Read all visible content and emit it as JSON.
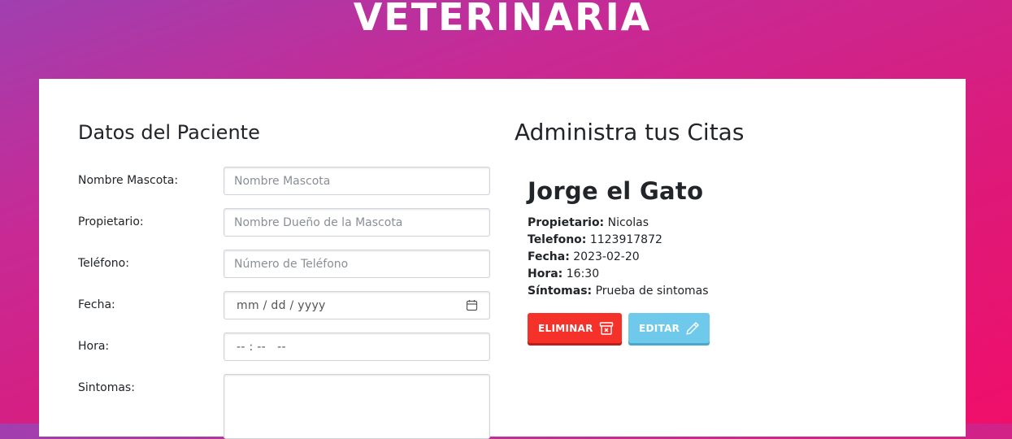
{
  "header": {
    "title": "VETERINARIA"
  },
  "form": {
    "title": "Datos del Paciente",
    "fields": [
      {
        "label": "Nombre Mascota:",
        "placeholder": "Nombre Mascota"
      },
      {
        "label": "Propietario:",
        "placeholder": "Nombre Dueño de la Mascota"
      },
      {
        "label": "Teléfono:",
        "placeholder": "Número de Teléfono"
      },
      {
        "label": "Fecha:",
        "display": "mm / dd / yyyy"
      },
      {
        "label": "Hora:",
        "display": "-- : --   --"
      },
      {
        "label": "Sintomas:",
        "placeholder": ""
      }
    ]
  },
  "list": {
    "title": "Administra tus Citas",
    "appointments": [
      {
        "pet": "Jorge el Gato",
        "owner_label": "Propietario:",
        "owner": "Nicolas",
        "phone_label": "Telefono:",
        "phone": "1123917872",
        "date_label": "Fecha:",
        "date": "2023-02-20",
        "time_label": "Hora:",
        "time": "16:30",
        "symptoms_label": "Síntomas:",
        "symptoms": "Prueba de sintomas",
        "delete_label": "ELIMINAR",
        "edit_label": "EDITAR"
      }
    ]
  },
  "icons": {
    "calendar": "calendar-icon",
    "delete": "archive-x-icon",
    "edit": "pencil-icon"
  },
  "colors": {
    "gradient_start": "#a03fb0",
    "gradient_end": "#ef0f6a",
    "danger": "#f4322a",
    "info": "#6ec9ea"
  }
}
